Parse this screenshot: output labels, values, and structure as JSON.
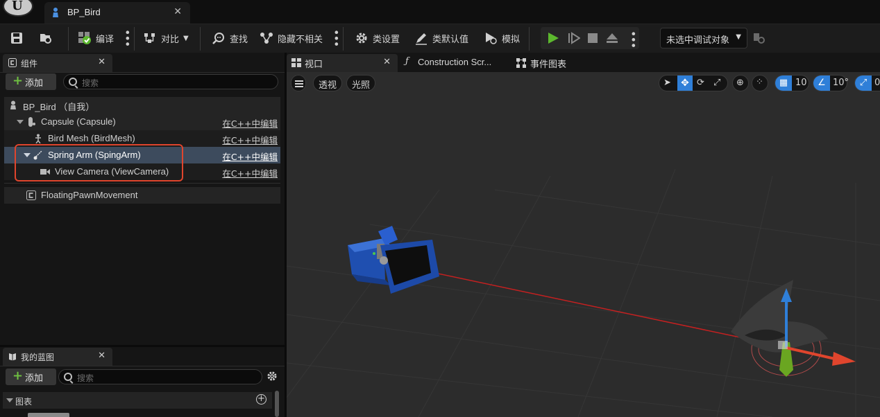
{
  "window": {
    "doc_tab_title": "BP_Bird",
    "close_glyph": "✕"
  },
  "toolbar": {
    "compile_label": "编译",
    "diff_label": "对比",
    "find_label": "查找",
    "hide_unrelated_label": "隐藏不相关",
    "class_settings_label": "类设置",
    "class_defaults_label": "类默认值",
    "simulate_label": "模拟",
    "debug_object": "未选中调试对象"
  },
  "components_panel": {
    "tab_label": "组件",
    "add_label": "添加",
    "search_placeholder": "搜索",
    "rows": [
      {
        "label": "BP_Bird （自我）",
        "edit": ""
      },
      {
        "label": "Capsule (Capsule)",
        "edit": "在C++中编辑"
      },
      {
        "label": "Bird Mesh (BirdMesh)",
        "edit": "在C++中编辑"
      },
      {
        "label": "Spring Arm (SpingArm)",
        "edit": "在C++中编辑"
      },
      {
        "label": "View Camera (ViewCamera)",
        "edit": "在C++中编辑"
      },
      {
        "label": "FloatingPawnMovement",
        "edit": ""
      }
    ]
  },
  "my_blueprint_panel": {
    "tab_label": "我的蓝图",
    "add_label": "添加",
    "search_placeholder": "搜索",
    "section_graphs": "图表"
  },
  "viewport_tabs": {
    "viewport": "视口",
    "construction_script": "Construction Scr...",
    "event_graph": "事件图表"
  },
  "viewport_toolbar": {
    "perspective": "透视",
    "lighting": "光照",
    "grid_snap": "10",
    "rotation_snap": "10°",
    "scale_snap": "0"
  },
  "colors": {
    "accent_blue": "#2f7fd8",
    "play_green": "#5cb82e",
    "highlight_red": "#e0452d",
    "selected_row": "#3d4b5d"
  }
}
